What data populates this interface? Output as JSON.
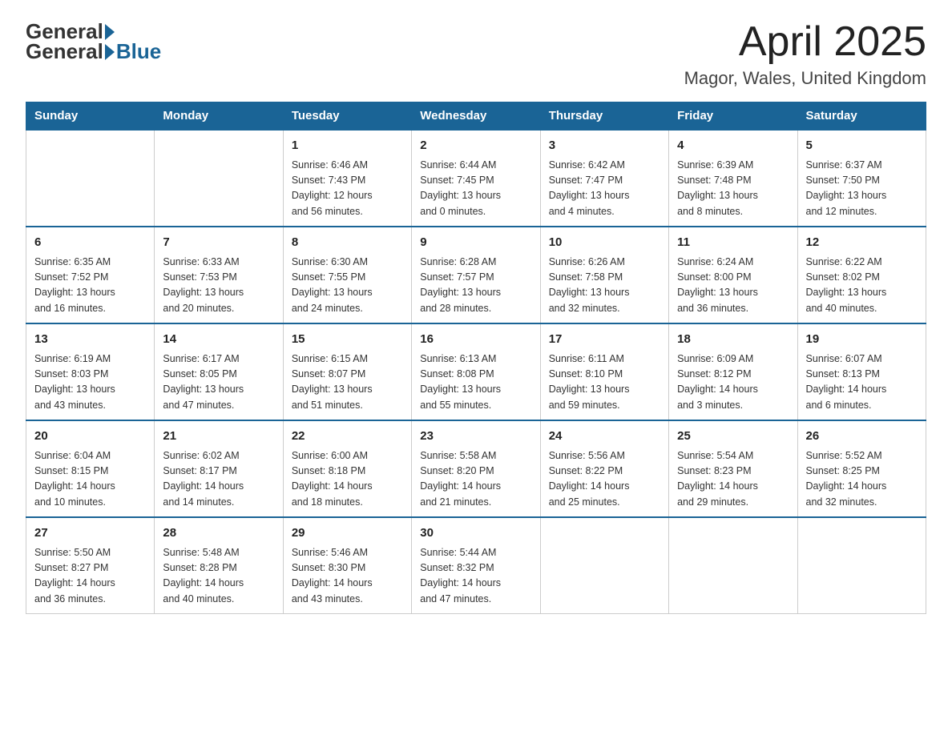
{
  "header": {
    "logo_general": "General",
    "logo_blue": "Blue",
    "month_title": "April 2025",
    "location": "Magor, Wales, United Kingdom"
  },
  "days_of_week": [
    "Sunday",
    "Monday",
    "Tuesday",
    "Wednesday",
    "Thursday",
    "Friday",
    "Saturday"
  ],
  "weeks": [
    [
      {
        "day": "",
        "info": ""
      },
      {
        "day": "",
        "info": ""
      },
      {
        "day": "1",
        "info": "Sunrise: 6:46 AM\nSunset: 7:43 PM\nDaylight: 12 hours\nand 56 minutes."
      },
      {
        "day": "2",
        "info": "Sunrise: 6:44 AM\nSunset: 7:45 PM\nDaylight: 13 hours\nand 0 minutes."
      },
      {
        "day": "3",
        "info": "Sunrise: 6:42 AM\nSunset: 7:47 PM\nDaylight: 13 hours\nand 4 minutes."
      },
      {
        "day": "4",
        "info": "Sunrise: 6:39 AM\nSunset: 7:48 PM\nDaylight: 13 hours\nand 8 minutes."
      },
      {
        "day": "5",
        "info": "Sunrise: 6:37 AM\nSunset: 7:50 PM\nDaylight: 13 hours\nand 12 minutes."
      }
    ],
    [
      {
        "day": "6",
        "info": "Sunrise: 6:35 AM\nSunset: 7:52 PM\nDaylight: 13 hours\nand 16 minutes."
      },
      {
        "day": "7",
        "info": "Sunrise: 6:33 AM\nSunset: 7:53 PM\nDaylight: 13 hours\nand 20 minutes."
      },
      {
        "day": "8",
        "info": "Sunrise: 6:30 AM\nSunset: 7:55 PM\nDaylight: 13 hours\nand 24 minutes."
      },
      {
        "day": "9",
        "info": "Sunrise: 6:28 AM\nSunset: 7:57 PM\nDaylight: 13 hours\nand 28 minutes."
      },
      {
        "day": "10",
        "info": "Sunrise: 6:26 AM\nSunset: 7:58 PM\nDaylight: 13 hours\nand 32 minutes."
      },
      {
        "day": "11",
        "info": "Sunrise: 6:24 AM\nSunset: 8:00 PM\nDaylight: 13 hours\nand 36 minutes."
      },
      {
        "day": "12",
        "info": "Sunrise: 6:22 AM\nSunset: 8:02 PM\nDaylight: 13 hours\nand 40 minutes."
      }
    ],
    [
      {
        "day": "13",
        "info": "Sunrise: 6:19 AM\nSunset: 8:03 PM\nDaylight: 13 hours\nand 43 minutes."
      },
      {
        "day": "14",
        "info": "Sunrise: 6:17 AM\nSunset: 8:05 PM\nDaylight: 13 hours\nand 47 minutes."
      },
      {
        "day": "15",
        "info": "Sunrise: 6:15 AM\nSunset: 8:07 PM\nDaylight: 13 hours\nand 51 minutes."
      },
      {
        "day": "16",
        "info": "Sunrise: 6:13 AM\nSunset: 8:08 PM\nDaylight: 13 hours\nand 55 minutes."
      },
      {
        "day": "17",
        "info": "Sunrise: 6:11 AM\nSunset: 8:10 PM\nDaylight: 13 hours\nand 59 minutes."
      },
      {
        "day": "18",
        "info": "Sunrise: 6:09 AM\nSunset: 8:12 PM\nDaylight: 14 hours\nand 3 minutes."
      },
      {
        "day": "19",
        "info": "Sunrise: 6:07 AM\nSunset: 8:13 PM\nDaylight: 14 hours\nand 6 minutes."
      }
    ],
    [
      {
        "day": "20",
        "info": "Sunrise: 6:04 AM\nSunset: 8:15 PM\nDaylight: 14 hours\nand 10 minutes."
      },
      {
        "day": "21",
        "info": "Sunrise: 6:02 AM\nSunset: 8:17 PM\nDaylight: 14 hours\nand 14 minutes."
      },
      {
        "day": "22",
        "info": "Sunrise: 6:00 AM\nSunset: 8:18 PM\nDaylight: 14 hours\nand 18 minutes."
      },
      {
        "day": "23",
        "info": "Sunrise: 5:58 AM\nSunset: 8:20 PM\nDaylight: 14 hours\nand 21 minutes."
      },
      {
        "day": "24",
        "info": "Sunrise: 5:56 AM\nSunset: 8:22 PM\nDaylight: 14 hours\nand 25 minutes."
      },
      {
        "day": "25",
        "info": "Sunrise: 5:54 AM\nSunset: 8:23 PM\nDaylight: 14 hours\nand 29 minutes."
      },
      {
        "day": "26",
        "info": "Sunrise: 5:52 AM\nSunset: 8:25 PM\nDaylight: 14 hours\nand 32 minutes."
      }
    ],
    [
      {
        "day": "27",
        "info": "Sunrise: 5:50 AM\nSunset: 8:27 PM\nDaylight: 14 hours\nand 36 minutes."
      },
      {
        "day": "28",
        "info": "Sunrise: 5:48 AM\nSunset: 8:28 PM\nDaylight: 14 hours\nand 40 minutes."
      },
      {
        "day": "29",
        "info": "Sunrise: 5:46 AM\nSunset: 8:30 PM\nDaylight: 14 hours\nand 43 minutes."
      },
      {
        "day": "30",
        "info": "Sunrise: 5:44 AM\nSunset: 8:32 PM\nDaylight: 14 hours\nand 47 minutes."
      },
      {
        "day": "",
        "info": ""
      },
      {
        "day": "",
        "info": ""
      },
      {
        "day": "",
        "info": ""
      }
    ]
  ]
}
